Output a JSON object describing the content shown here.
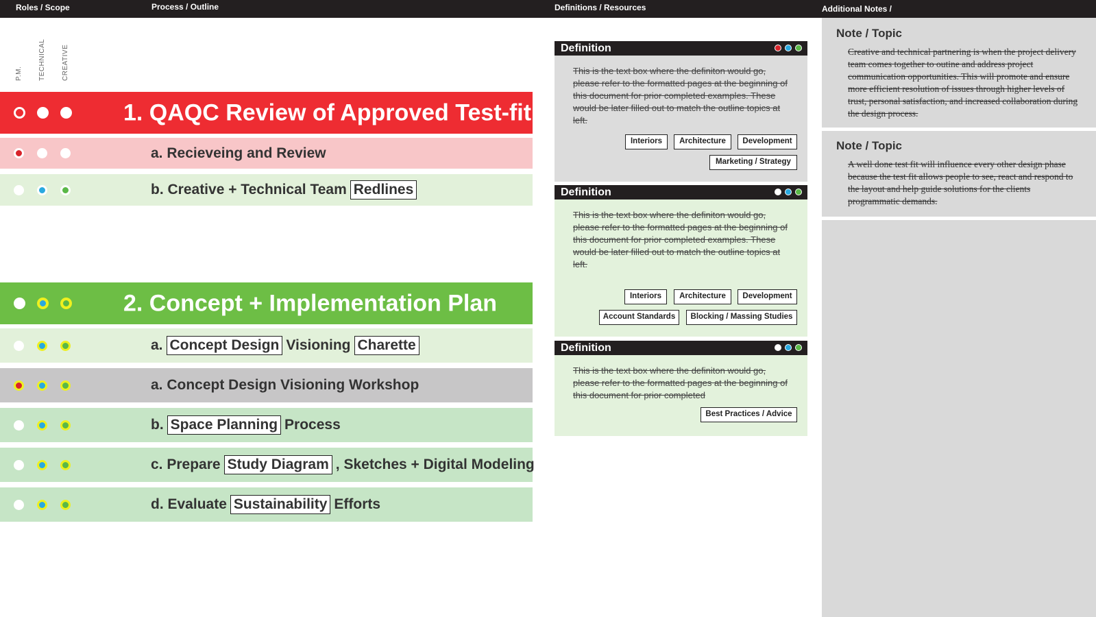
{
  "header": {
    "roles": "Roles / Scope",
    "process": "Process / Outline",
    "definitions": "Definitions / Resources",
    "notes": "Additional Notes /"
  },
  "roles": [
    "P.M.",
    "TECHNICAL",
    "CREATIVE"
  ],
  "colors": {
    "red": "#ee2c32",
    "pink": "#f8c6c8",
    "light_green": "#e2f1da",
    "green": "#6dbe45",
    "mid_green": "#c6e5c6",
    "gray_row": "#c7c6c7",
    "def_gray": "#dcdcdc",
    "def_green": "#e3f2dc",
    "dot_red": "#d8232a",
    "dot_blue": "#29a9e0",
    "dot_green": "#5ab847",
    "dot_yellow": "#eef01f"
  },
  "outline": [
    {
      "text": "1. QAQC Review of Approved Test-fit",
      "big": true
    },
    {
      "text": "a. Recieveing and Review"
    },
    {
      "pre": "b. Creative + Technical Team",
      "box1": "Redlines"
    },
    {
      "text": "2. Concept + Implementation Plan",
      "big": true
    },
    {
      "pre": "a.",
      "box1": "Concept Design",
      "mid": "Visioning",
      "box2": "Charette"
    },
    {
      "text": "a. Concept Design Visioning Workshop"
    },
    {
      "pre": "b.",
      "box1": "Space Planning",
      "post": "Process"
    },
    {
      "pre": "c. Prepare",
      "box1": "Study Diagram",
      "post": ", Sketches + Digital Modeling"
    },
    {
      "pre": "d. Evaluate",
      "box1": "Sustainability",
      "post": "Efforts"
    }
  ],
  "definitions": [
    {
      "title": "Definition",
      "text": "This is the text box where the definiton would go, please refer to the formatted pages at the beginning of this document for prior completed examples. These would be later filled out to match the outline topics at left.",
      "tags": [
        "Interiors",
        "Architecture",
        "Development",
        "Marketing / Strategy"
      ]
    },
    {
      "title": "Definition",
      "text": "This is the text box where the definiton would go, please refer to the formatted pages at the beginning of this document for prior completed examples. These would be later filled out to match the outline topics at left.",
      "tags": [
        "Interiors",
        "Architecture",
        "Development",
        "Account Standards",
        "Blocking / Massing Studies"
      ]
    },
    {
      "title": "Definition",
      "text": "This is the text box where the definiton would go, please refer to the formatted pages at the beginning of this document for prior completed",
      "tags": [
        "Best Practices / Advice"
      ]
    }
  ],
  "notes": [
    {
      "title": "Note / Topic",
      "text": "Creative and technical partnering is when the project delivery team comes together to outine and address project communication opportunities. This will promote and ensure more efficient resolution of issues through higher levels of trust, personal satisfaction, and increased collaboration during the design process."
    },
    {
      "title": "Note / Topic",
      "text": "A well done test fit will influence every other  design phase because the test fit allows people to see, react and respond to the layout and help guide solutions for the clients programmatic demands."
    }
  ]
}
